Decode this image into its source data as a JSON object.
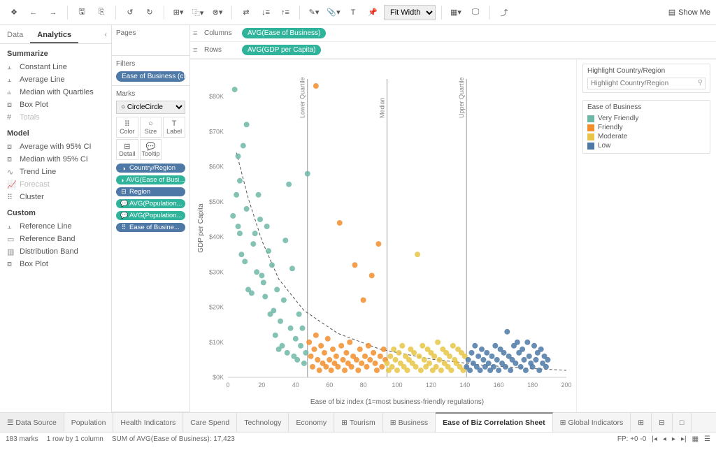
{
  "toolbar": {
    "fit_options": [
      "Fit Width"
    ],
    "fit_selected": "Fit Width",
    "showme_label": "Show Me"
  },
  "tabs": {
    "data": "Data",
    "analytics": "Analytics"
  },
  "analytics": {
    "summarize_title": "Summarize",
    "summarize_items": [
      {
        "label": "Constant Line",
        "disabled": false
      },
      {
        "label": "Average Line",
        "disabled": false
      },
      {
        "label": "Median with Quartiles",
        "disabled": false
      },
      {
        "label": "Box Plot",
        "disabled": false
      },
      {
        "label": "Totals",
        "disabled": true
      }
    ],
    "model_title": "Model",
    "model_items": [
      {
        "label": "Average with 95% CI",
        "disabled": false
      },
      {
        "label": "Median with 95% CI",
        "disabled": false
      },
      {
        "label": "Trend Line",
        "disabled": false
      },
      {
        "label": "Forecast",
        "disabled": true
      },
      {
        "label": "Cluster",
        "disabled": false
      }
    ],
    "custom_title": "Custom",
    "custom_items": [
      {
        "label": "Reference Line"
      },
      {
        "label": "Reference Band"
      },
      {
        "label": "Distribution Band"
      },
      {
        "label": "Box Plot"
      }
    ]
  },
  "shelves": {
    "pages_label": "Pages",
    "filters_label": "Filters",
    "filters": [
      "Ease of Business (cl..."
    ],
    "marks_label": "Marks",
    "marks_shape": "Circle",
    "marks_cells": [
      "Color",
      "Size",
      "Label",
      "Detail",
      "Tooltip"
    ],
    "marks_pills": [
      {
        "text": "Country/Region",
        "color": "blue",
        "ico": "◑"
      },
      {
        "text": "AVG(Ease of Busi...",
        "color": "teal",
        "ico": "◑"
      },
      {
        "text": "Region",
        "color": "blue",
        "ico": "⊟"
      },
      {
        "text": "AVG(Population...",
        "color": "teal",
        "ico": "💬"
      },
      {
        "text": "AVG(Population...",
        "color": "teal",
        "ico": "💬"
      },
      {
        "text": "Ease of Busine...",
        "color": "blue",
        "ico": "⠿"
      }
    ],
    "columns_label": "Columns",
    "columns_pill": "AVG(Ease of Business)",
    "rows_label": "Rows",
    "rows_pill": "AVG(GDP per Capita)"
  },
  "highlight": {
    "title": "Highlight Country/Region",
    "placeholder": "Highlight Country/Region"
  },
  "legend": {
    "title": "Ease of Business",
    "items": [
      {
        "label": "Very Friendly",
        "color": "#6fb7a6"
      },
      {
        "label": "Friendly",
        "color": "#f28e2b"
      },
      {
        "label": "Moderate",
        "color": "#e8c547"
      },
      {
        "label": "Low",
        "color": "#4e79a7"
      }
    ]
  },
  "chart_data": {
    "type": "scatter",
    "xlabel": "Ease of biz index (1=most business-friendly regulations)",
    "ylabel": "GDP per Capita",
    "xlim": [
      0,
      200
    ],
    "ylim": [
      0,
      85000
    ],
    "xticks": [
      0,
      20,
      40,
      60,
      80,
      100,
      120,
      140,
      160,
      180,
      200
    ],
    "yticks": [
      0,
      10000,
      20000,
      30000,
      40000,
      50000,
      60000,
      70000,
      80000
    ],
    "ytick_labels": [
      "$0K",
      "$10K",
      "$20K",
      "$30K",
      "$40K",
      "$50K",
      "$60K",
      "$70K",
      "$80K"
    ],
    "reference_lines": [
      {
        "x": 47,
        "label": "Lower Quartile"
      },
      {
        "x": 94,
        "label": "Median"
      },
      {
        "x": 141,
        "label": "Upper Quartile"
      }
    ],
    "trend_curve": [
      [
        5,
        64000
      ],
      [
        12,
        51000
      ],
      [
        20,
        39000
      ],
      [
        30,
        28000
      ],
      [
        45,
        19000
      ],
      [
        65,
        12500
      ],
      [
        90,
        8000
      ],
      [
        120,
        5200
      ],
      [
        150,
        3500
      ],
      [
        180,
        2500
      ],
      [
        200,
        2000
      ]
    ],
    "series": [
      {
        "name": "Very Friendly",
        "color": "#6fb7a6",
        "points": [
          [
            3,
            46000
          ],
          [
            4,
            82000
          ],
          [
            5,
            52000
          ],
          [
            6,
            43000
          ],
          [
            7,
            41000
          ],
          [
            7,
            56000
          ],
          [
            8,
            35000
          ],
          [
            9,
            66000
          ],
          [
            10,
            33000
          ],
          [
            11,
            48000
          ],
          [
            12,
            25000
          ],
          [
            14,
            24000
          ],
          [
            15,
            38000
          ],
          [
            16,
            41000
          ],
          [
            17,
            30000
          ],
          [
            18,
            52000
          ],
          [
            19,
            45000
          ],
          [
            20,
            29000
          ],
          [
            21,
            27000
          ],
          [
            22,
            23000
          ],
          [
            24,
            36000
          ],
          [
            25,
            18000
          ],
          [
            26,
            32000
          ],
          [
            27,
            19000
          ],
          [
            28,
            12000
          ],
          [
            29,
            25000
          ],
          [
            30,
            8000
          ],
          [
            31,
            16000
          ],
          [
            32,
            9000
          ],
          [
            33,
            22000
          ],
          [
            34,
            39000
          ],
          [
            35,
            7000
          ],
          [
            36,
            55000
          ],
          [
            37,
            14000
          ],
          [
            38,
            31000
          ],
          [
            39,
            6000
          ],
          [
            40,
            11000
          ],
          [
            41,
            5000
          ],
          [
            42,
            18000
          ],
          [
            43,
            9000
          ],
          [
            44,
            14000
          ],
          [
            45,
            4000
          ],
          [
            46,
            7000
          ],
          [
            11,
            72000
          ],
          [
            23,
            43000
          ],
          [
            6,
            63000
          ],
          [
            47,
            58000
          ]
        ]
      },
      {
        "name": "Friendly",
        "color": "#f28e2b",
        "points": [
          [
            48,
            10000
          ],
          [
            49,
            6000
          ],
          [
            50,
            3000
          ],
          [
            51,
            8000
          ],
          [
            52,
            12000
          ],
          [
            53,
            5000
          ],
          [
            54,
            2000
          ],
          [
            55,
            9000
          ],
          [
            56,
            4000
          ],
          [
            57,
            7000
          ],
          [
            58,
            3000
          ],
          [
            59,
            11000
          ],
          [
            60,
            5000
          ],
          [
            61,
            2000
          ],
          [
            62,
            8000
          ],
          [
            63,
            4000
          ],
          [
            64,
            6000
          ],
          [
            65,
            3000
          ],
          [
            66,
            44000
          ],
          [
            67,
            9000
          ],
          [
            68,
            5000
          ],
          [
            69,
            2000
          ],
          [
            70,
            7000
          ],
          [
            71,
            4000
          ],
          [
            72,
            10000
          ],
          [
            73,
            3000
          ],
          [
            74,
            6000
          ],
          [
            75,
            32000
          ],
          [
            76,
            5000
          ],
          [
            77,
            2000
          ],
          [
            78,
            8000
          ],
          [
            79,
            4000
          ],
          [
            80,
            22000
          ],
          [
            81,
            6000
          ],
          [
            82,
            3000
          ],
          [
            83,
            9000
          ],
          [
            84,
            5000
          ],
          [
            85,
            29000
          ],
          [
            86,
            7000
          ],
          [
            87,
            4000
          ],
          [
            88,
            2000
          ],
          [
            89,
            38000
          ],
          [
            90,
            6000
          ],
          [
            91,
            3000
          ],
          [
            92,
            8000
          ],
          [
            93,
            5000
          ],
          [
            52,
            83000
          ]
        ]
      },
      {
        "name": "Moderate",
        "color": "#e8c547",
        "points": [
          [
            94,
            4000
          ],
          [
            95,
            2000
          ],
          [
            96,
            6000
          ],
          [
            97,
            3000
          ],
          [
            98,
            8000
          ],
          [
            99,
            5000
          ],
          [
            100,
            2000
          ],
          [
            101,
            7000
          ],
          [
            102,
            4000
          ],
          [
            103,
            9000
          ],
          [
            104,
            3000
          ],
          [
            105,
            6000
          ],
          [
            106,
            2000
          ],
          [
            107,
            5000
          ],
          [
            108,
            8000
          ],
          [
            109,
            4000
          ],
          [
            110,
            7000
          ],
          [
            111,
            3000
          ],
          [
            112,
            35000
          ],
          [
            113,
            6000
          ],
          [
            114,
            2000
          ],
          [
            115,
            9000
          ],
          [
            116,
            5000
          ],
          [
            117,
            3000
          ],
          [
            118,
            8000
          ],
          [
            119,
            4000
          ],
          [
            120,
            7000
          ],
          [
            121,
            2000
          ],
          [
            122,
            6000
          ],
          [
            123,
            3000
          ],
          [
            124,
            10000
          ],
          [
            125,
            5000
          ],
          [
            126,
            2000
          ],
          [
            127,
            8000
          ],
          [
            128,
            4000
          ],
          [
            129,
            7000
          ],
          [
            130,
            3000
          ],
          [
            131,
            6000
          ],
          [
            132,
            2000
          ],
          [
            133,
            9000
          ],
          [
            134,
            5000
          ],
          [
            135,
            4000
          ],
          [
            136,
            8000
          ],
          [
            137,
            3000
          ],
          [
            138,
            7000
          ],
          [
            139,
            2000
          ],
          [
            140,
            6000
          ]
        ]
      },
      {
        "name": "Low",
        "color": "#4e79a7",
        "points": [
          [
            141,
            3000
          ],
          [
            142,
            5000
          ],
          [
            143,
            2000
          ],
          [
            144,
            7000
          ],
          [
            145,
            4000
          ],
          [
            146,
            9000
          ],
          [
            147,
            3000
          ],
          [
            148,
            6000
          ],
          [
            149,
            2000
          ],
          [
            150,
            8000
          ],
          [
            151,
            5000
          ],
          [
            152,
            3000
          ],
          [
            153,
            7000
          ],
          [
            154,
            4000
          ],
          [
            155,
            2000
          ],
          [
            156,
            6000
          ],
          [
            157,
            3000
          ],
          [
            158,
            9000
          ],
          [
            159,
            5000
          ],
          [
            160,
            2000
          ],
          [
            161,
            8000
          ],
          [
            162,
            4000
          ],
          [
            163,
            7000
          ],
          [
            164,
            3000
          ],
          [
            165,
            13000
          ],
          [
            166,
            6000
          ],
          [
            167,
            2000
          ],
          [
            168,
            5000
          ],
          [
            169,
            9000
          ],
          [
            170,
            4000
          ],
          [
            171,
            10000
          ],
          [
            172,
            7000
          ],
          [
            173,
            3000
          ],
          [
            174,
            8000
          ],
          [
            175,
            5000
          ],
          [
            176,
            2000
          ],
          [
            177,
            10000
          ],
          [
            178,
            6000
          ],
          [
            179,
            4000
          ],
          [
            180,
            3000
          ],
          [
            181,
            9000
          ],
          [
            182,
            5000
          ],
          [
            183,
            7000
          ],
          [
            184,
            2000
          ],
          [
            185,
            8000
          ],
          [
            186,
            4000
          ],
          [
            187,
            6000
          ],
          [
            188,
            3000
          ],
          [
            189,
            5000
          ]
        ]
      }
    ]
  },
  "sheet_tabs": [
    {
      "label": "Data Source",
      "type": "ds"
    },
    {
      "label": "Population"
    },
    {
      "label": "Health Indicators"
    },
    {
      "label": "Care Spend"
    },
    {
      "label": "Technology"
    },
    {
      "label": "Economy"
    },
    {
      "label": "Tourism",
      "icon": "⊞"
    },
    {
      "label": "Business",
      "icon": "⊞"
    },
    {
      "label": "Ease of Biz Correlation Sheet",
      "active": true
    },
    {
      "label": "Global Indicators",
      "icon": "⊞"
    }
  ],
  "status": {
    "marks": "183 marks",
    "dims": "1 row by 1 column",
    "sum": "SUM of AVG(Ease of Business): 17,423",
    "fp": "FP: +0 -0"
  }
}
